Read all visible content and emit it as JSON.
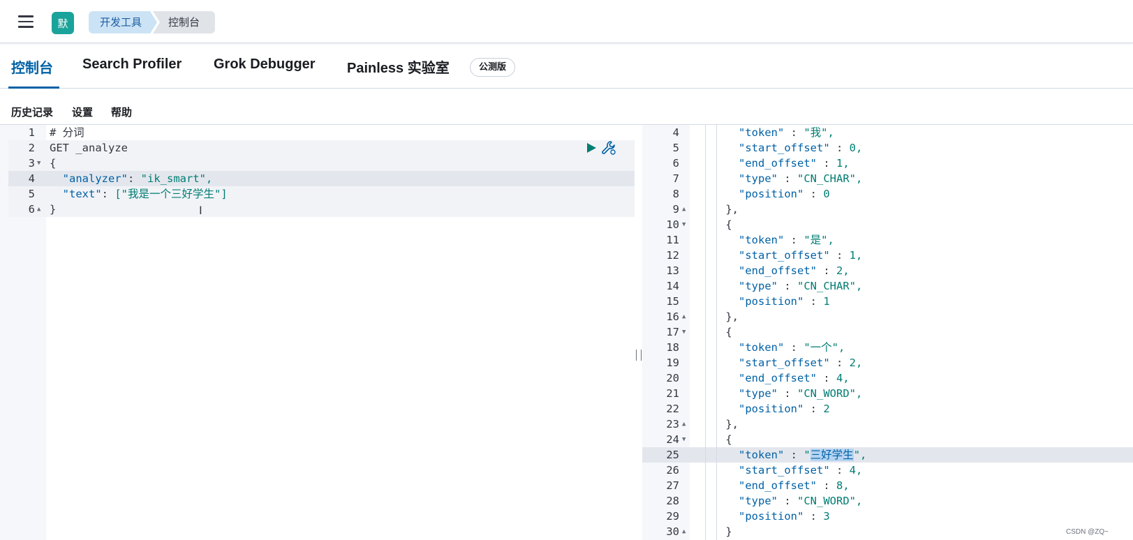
{
  "header": {
    "space_initial": "默",
    "breadcrumbs": [
      "开发工具",
      "控制台"
    ]
  },
  "tabs": [
    {
      "label": "控制台",
      "active": true
    },
    {
      "label": "Search Profiler",
      "active": false
    },
    {
      "label": "Grok Debugger",
      "active": false
    },
    {
      "label": "Painless 实验室",
      "active": false
    }
  ],
  "beta_badge": "公测版",
  "toolbar": {
    "history": "历史记录",
    "settings": "设置",
    "help": "帮助"
  },
  "request_editor": {
    "lines": [
      {
        "num": "1",
        "fold": "",
        "text": "# 分词"
      },
      {
        "num": "2",
        "fold": "",
        "text": "GET _analyze"
      },
      {
        "num": "3",
        "fold": "▼",
        "text": "{"
      },
      {
        "num": "4",
        "fold": "",
        "text": "  \"analyzer\": \"ik_smart\","
      },
      {
        "num": "5",
        "fold": "",
        "text": "  \"text\": [\"我是一个三好学生\"]"
      },
      {
        "num": "6",
        "fold": "▲",
        "text": "}"
      }
    ]
  },
  "response_editor": {
    "lines": [
      {
        "num": "4",
        "fold": "",
        "text": "      \"token\" : \"我\","
      },
      {
        "num": "5",
        "fold": "",
        "text": "      \"start_offset\" : 0,"
      },
      {
        "num": "6",
        "fold": "",
        "text": "      \"end_offset\" : 1,"
      },
      {
        "num": "7",
        "fold": "",
        "text": "      \"type\" : \"CN_CHAR\","
      },
      {
        "num": "8",
        "fold": "",
        "text": "      \"position\" : 0"
      },
      {
        "num": "9",
        "fold": "▲",
        "text": "    },"
      },
      {
        "num": "10",
        "fold": "▼",
        "text": "    {"
      },
      {
        "num": "11",
        "fold": "",
        "text": "      \"token\" : \"是\","
      },
      {
        "num": "12",
        "fold": "",
        "text": "      \"start_offset\" : 1,"
      },
      {
        "num": "13",
        "fold": "",
        "text": "      \"end_offset\" : 2,"
      },
      {
        "num": "14",
        "fold": "",
        "text": "      \"type\" : \"CN_CHAR\","
      },
      {
        "num": "15",
        "fold": "",
        "text": "      \"position\" : 1"
      },
      {
        "num": "16",
        "fold": "▲",
        "text": "    },"
      },
      {
        "num": "17",
        "fold": "▼",
        "text": "    {"
      },
      {
        "num": "18",
        "fold": "",
        "text": "      \"token\" : \"一个\","
      },
      {
        "num": "19",
        "fold": "",
        "text": "      \"start_offset\" : 2,"
      },
      {
        "num": "20",
        "fold": "",
        "text": "      \"end_offset\" : 4,"
      },
      {
        "num": "21",
        "fold": "",
        "text": "      \"type\" : \"CN_WORD\","
      },
      {
        "num": "22",
        "fold": "",
        "text": "      \"position\" : 2"
      },
      {
        "num": "23",
        "fold": "▲",
        "text": "    },"
      },
      {
        "num": "24",
        "fold": "▼",
        "text": "    {"
      },
      {
        "num": "25",
        "fold": "",
        "text": "      \"token\" : \"三好学生\","
      },
      {
        "num": "26",
        "fold": "",
        "text": "      \"start_offset\" : 4,"
      },
      {
        "num": "27",
        "fold": "",
        "text": "      \"end_offset\" : 8,"
      },
      {
        "num": "28",
        "fold": "",
        "text": "      \"type\" : \"CN_WORD\","
      },
      {
        "num": "29",
        "fold": "",
        "text": "      \"position\" : 3"
      },
      {
        "num": "30",
        "fold": "▲",
        "text": "    }"
      }
    ],
    "selected_text": "三好学生"
  },
  "icons": {
    "menu": "hamburger-icon",
    "run": "play-icon",
    "actions": "wrench-icon",
    "resize": "resize-grip-icon"
  },
  "watermark": "CSDN @ZQ~"
}
